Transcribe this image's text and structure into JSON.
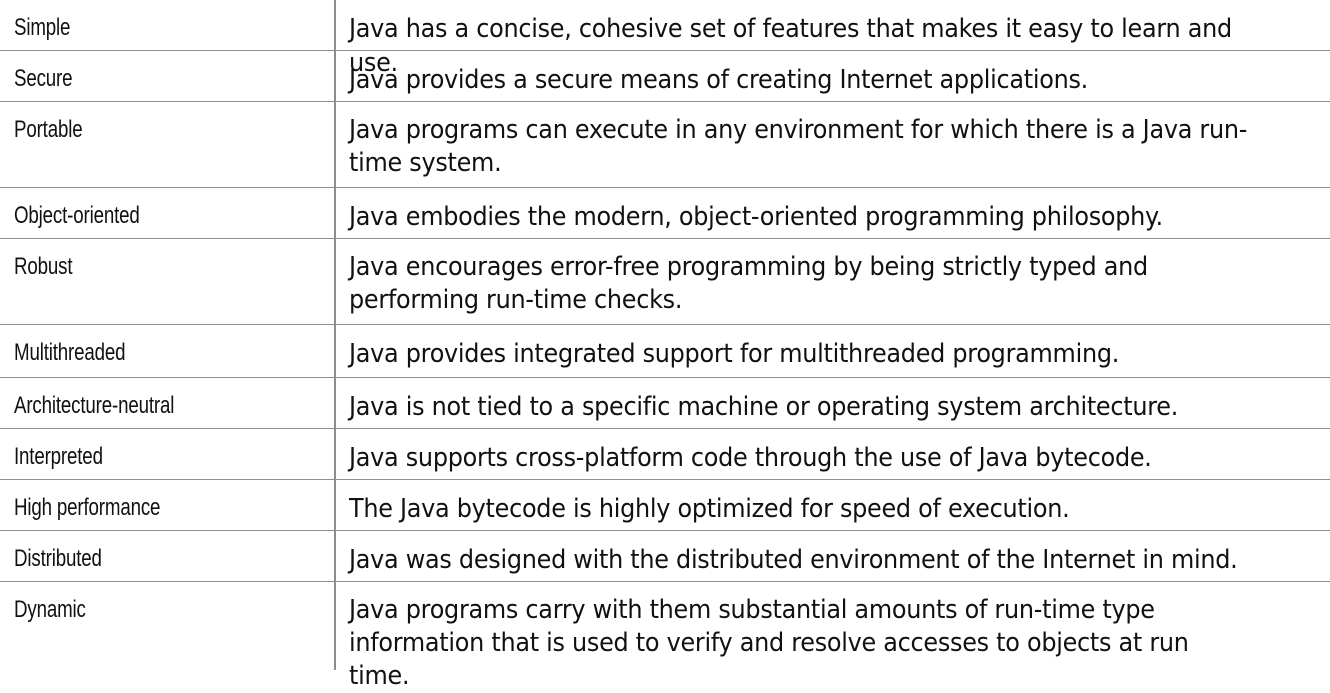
{
  "rows": [
    {
      "term": "Simple",
      "description": "Java has a concise, cohesive set of features that makes it easy to learn and use."
    },
    {
      "term": "Secure",
      "description": "Java provides a secure means of creating Internet applications."
    },
    {
      "term": "Portable",
      "description": "Java programs can execute in any environment for which there is a Java run-time system."
    },
    {
      "term": "Object-oriented",
      "description": "Java embodies the modern, object-oriented programming philosophy."
    },
    {
      "term": "Robust",
      "description": "Java encourages error-free programming by being strictly typed and performing run-time checks."
    },
    {
      "term": "Multithreaded",
      "description": "Java provides integrated support for multithreaded programming."
    },
    {
      "term": "Architecture-neutral",
      "description": "Java is not tied to a specific machine or operating system architecture."
    },
    {
      "term": "Interpreted",
      "description": "Java supports cross-platform code through the use of Java bytecode."
    },
    {
      "term": "High performance",
      "description": "The Java bytecode is highly optimized for speed of execution."
    },
    {
      "term": "Distributed",
      "description": "Java was designed with the distributed environment of the Internet in mind."
    },
    {
      "term": "Dynamic",
      "description": "Java programs carry with them substantial amounts of run-time type information that is used to verify and resolve accesses to objects at run time."
    }
  ]
}
